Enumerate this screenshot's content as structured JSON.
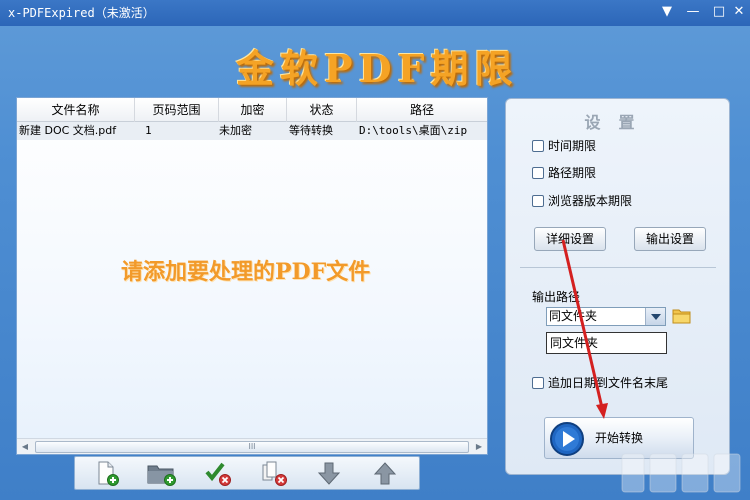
{
  "window": {
    "title": "x-PDFExpired（未激活）",
    "menu_glyph": "▼",
    "min_glyph": "—",
    "max_glyph": "□",
    "close_glyph": "✕"
  },
  "brand": {
    "text": "金软PDF期限"
  },
  "filelist": {
    "columns": [
      "文件名称",
      "页码范围",
      "加密",
      "状态",
      "路径"
    ],
    "rows": [
      {
        "name": "新建 DOC 文档.pdf",
        "pages": "1",
        "encrypt": "未加密",
        "status": "等待转换",
        "path": "D:\\tools\\桌面\\zip"
      }
    ],
    "hint": "请添加要处理的PDF文件",
    "scroll_thumb": "III"
  },
  "toolbar": {
    "icons": [
      "add-file-icon",
      "add-folder-icon",
      "remove-checked-icon",
      "remove-all-icon",
      "move-down-icon",
      "move-up-icon"
    ]
  },
  "settings": {
    "title": "设置",
    "checkboxes": [
      {
        "label": "时间期限",
        "checked": false
      },
      {
        "label": "路径期限",
        "checked": false
      },
      {
        "label": "浏览器版本期限",
        "checked": false
      }
    ],
    "detail_button": "详细设置",
    "output_button": "输出设置",
    "output_path_label": "输出路径",
    "output_select_value": "同文件夹",
    "output_path_value": "同文件夹",
    "append_date_label": "追加日期到文件名末尾",
    "append_date_checked": false,
    "start_button": "开始转换"
  },
  "colors": {
    "accent_orange": "#f29a2a",
    "annotation_red": "#d42020",
    "background_blue": "#4f8fd3"
  }
}
